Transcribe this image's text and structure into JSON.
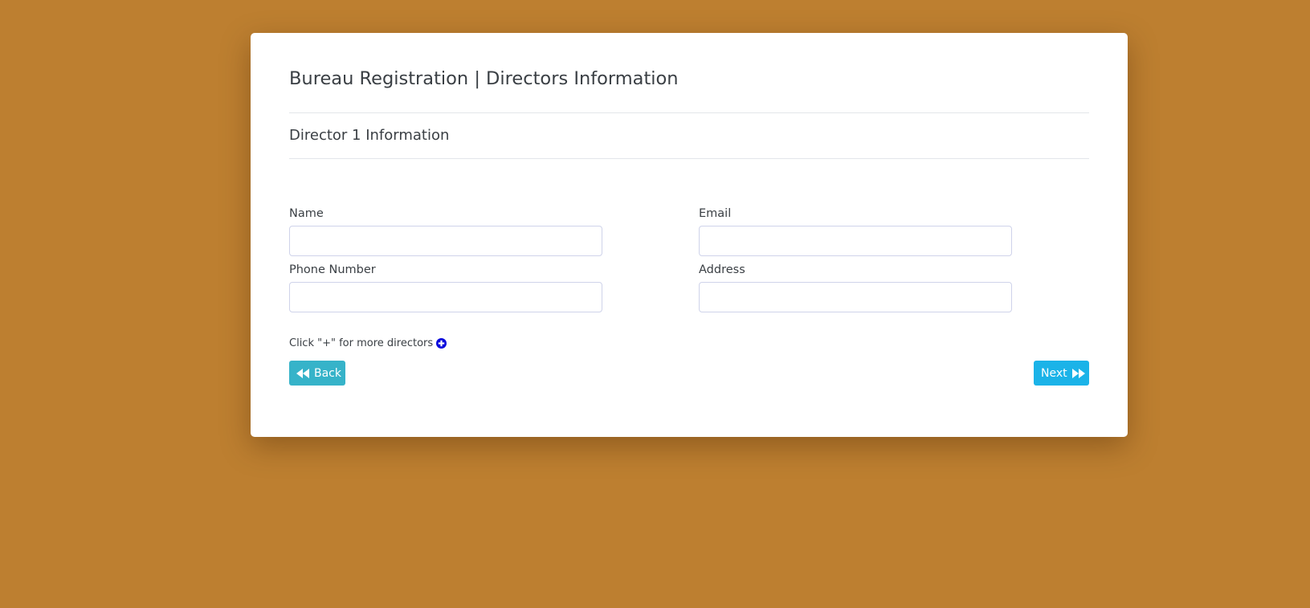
{
  "page": {
    "title": "Bureau Registration | Directors Information",
    "background_color": "#bd7f30"
  },
  "section": {
    "title": "Director 1 Information"
  },
  "form": {
    "name_label": "Name",
    "name_value": "",
    "email_label": "Email",
    "email_value": "",
    "phone_label": "Phone Number",
    "phone_value": "",
    "address_label": "Address",
    "address_value": ""
  },
  "add_more": {
    "text": "Click \"+\" for more directors",
    "icon": "plus-circle-icon",
    "icon_color": "#0a0adc"
  },
  "buttons": {
    "back_label": "Back",
    "back_icon": "fast-backward-icon",
    "back_color": "#36b3c9",
    "next_label": "Next",
    "next_icon": "fast-forward-icon",
    "next_color": "#1bb3e8"
  }
}
